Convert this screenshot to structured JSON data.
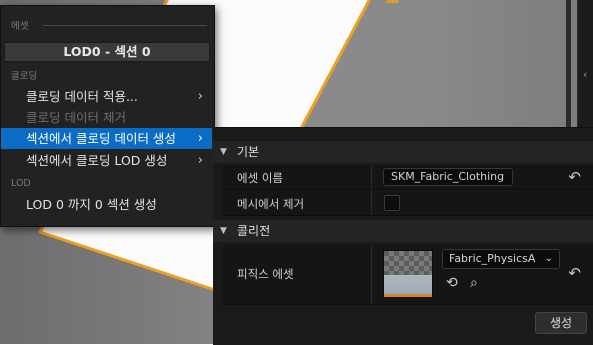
{
  "menu": {
    "section_asset": "에셋",
    "title": "LOD0 - 섹션 0",
    "section_cloth": "클로딩",
    "items": [
      {
        "label": "클로딩 데이터 적용...",
        "state": "normal",
        "has_submenu": true
      },
      {
        "label": "클로딩 데이터 제거",
        "state": "disabled",
        "has_submenu": false
      },
      {
        "label": "섹션에서 클로딩 데이터 생성",
        "state": "highlighted",
        "has_submenu": true
      },
      {
        "label": "섹션에서 클로딩 LOD 생성",
        "state": "normal",
        "has_submenu": true
      }
    ],
    "section_lod": "LOD",
    "lod_item": "LOD 0 까지 0 섹션 생성",
    "highlight_color": "#0a6cc4"
  },
  "details": {
    "basic_category": "기본",
    "asset_name_label": "에셋 이름",
    "asset_name_value": "SKM_Fabric_Clothing",
    "remove_from_mesh_label": "메시에서 제거",
    "remove_from_mesh_checked": false,
    "collision_category": "콜리전",
    "physics_asset_label": "피직스 에셋",
    "physics_asset_value": "Fabric_PhysicsA",
    "generate_button": "생성"
  },
  "icons": {
    "reset": "reset-arrow-icon",
    "browse": "browse-to-asset-icon",
    "find": "find-in-content-browser-icon",
    "collapse": "collapse-triangle-icon"
  },
  "colors": {
    "viewport_outline": "#f0a020",
    "panel_bg": "#1a1a1a"
  }
}
